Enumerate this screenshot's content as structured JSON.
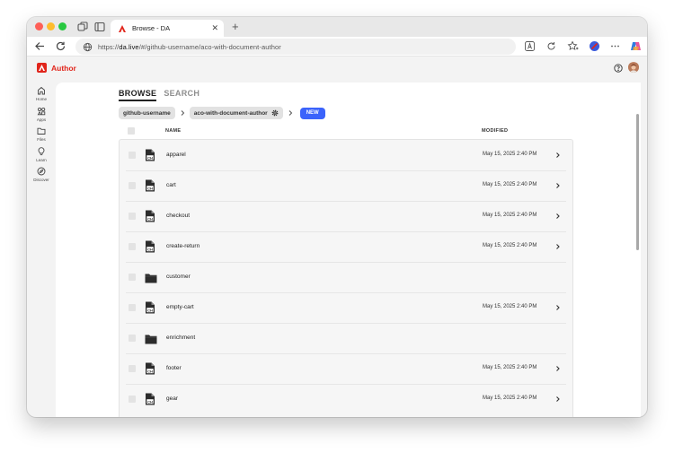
{
  "browser": {
    "tab_title": "Browse - DA",
    "url_prefix": "https://",
    "url_host": "da.live",
    "url_path": "/#/github-username/aco-with-document-author"
  },
  "app": {
    "name": "Author",
    "brand_color": "#e1251b"
  },
  "sidenav": [
    {
      "label": "Home",
      "icon": "home-icon"
    },
    {
      "label": "Apps",
      "icon": "apps-icon"
    },
    {
      "label": "Files",
      "icon": "folder-icon"
    },
    {
      "label": "Learn",
      "icon": "lightbulb-icon"
    },
    {
      "label": "Discover",
      "icon": "compass-icon"
    }
  ],
  "tabs": {
    "browse": "BROWSE",
    "search": "SEARCH"
  },
  "breadcrumb": {
    "owner": "github-username",
    "repo": "aco-with-document-author",
    "new_label": "NEW",
    "new_color": "#3b63fb"
  },
  "list_header": {
    "name": "NAME",
    "modified": "MODIFIED"
  },
  "rows": [
    {
      "name": "apparel",
      "type": "document",
      "modified": "May 15, 2025 2:40 PM"
    },
    {
      "name": "cart",
      "type": "document",
      "modified": "May 15, 2025 2:40 PM"
    },
    {
      "name": "checkout",
      "type": "document",
      "modified": "May 15, 2025 2:40 PM"
    },
    {
      "name": "create-return",
      "type": "document",
      "modified": "May 15, 2025 2:40 PM"
    },
    {
      "name": "customer",
      "type": "folder",
      "modified": ""
    },
    {
      "name": "empty-cart",
      "type": "document",
      "modified": "May 15, 2025 2:40 PM"
    },
    {
      "name": "enrichment",
      "type": "folder",
      "modified": ""
    },
    {
      "name": "footer",
      "type": "document",
      "modified": "May 15, 2025 2:40 PM"
    },
    {
      "name": "gear",
      "type": "document",
      "modified": "May 15, 2025 2:40 PM"
    }
  ]
}
